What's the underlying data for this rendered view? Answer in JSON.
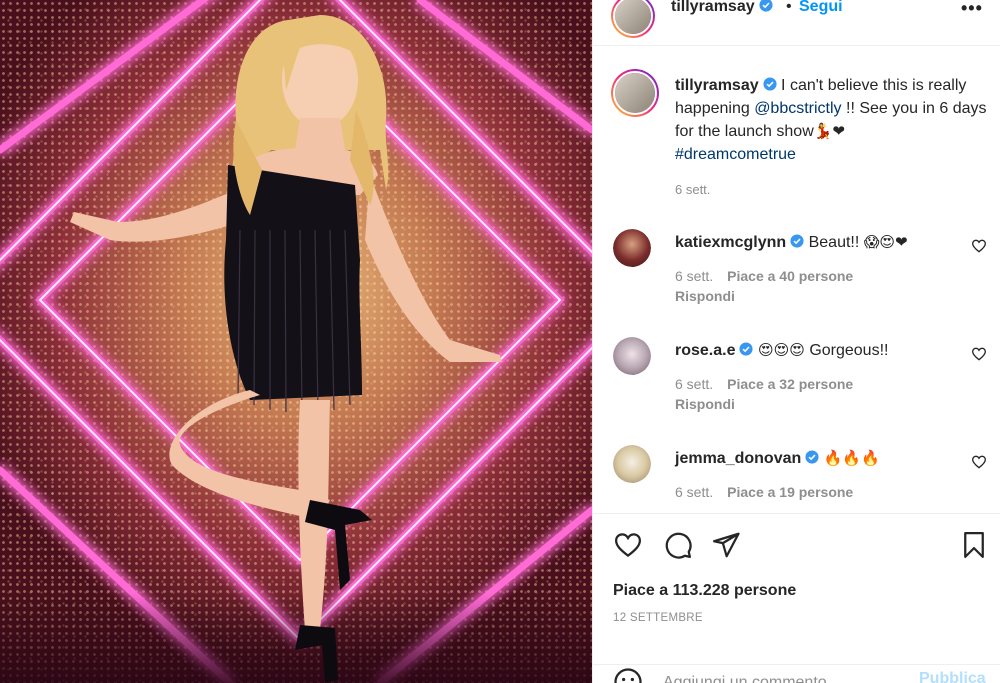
{
  "photo": {
    "description_icon": "photo-dancer",
    "neon_color": "#ff6ad5",
    "dress_color": "#141018",
    "hair_color": "#e9c27a"
  },
  "header": {
    "username": "tillyramsay",
    "separator": "•",
    "follow_label": "Segui",
    "more_icon": "more-horizontal-icon",
    "more_label": "•••"
  },
  "caption": {
    "username": "tillyramsay",
    "text_before": " I can't believe this is really happening ",
    "mention": "@bbcstrictly",
    "text_after": " !! See you in 6 days for the launch show",
    "emoji": "💃❤",
    "hashtag": "#dreamcometrue",
    "time": "6 sett."
  },
  "comments": [
    {
      "username": "katiexmcglynn",
      "verified": true,
      "text": "Beaut!!",
      "emoji": "😱😍❤",
      "time": "6 sett.",
      "likes": "Piace a 40 persone",
      "reply": "Rispondi",
      "avatar_color": "#7a2b2b"
    },
    {
      "username": "rose.a.e",
      "verified": true,
      "emoji": "😍😍😍",
      "text": "Gorgeous!!",
      "time": "6 sett.",
      "likes": "Piace a 32 persone",
      "reply": "Rispondi",
      "avatar_color": "#b8a7b3"
    },
    {
      "username": "jemma_donovan",
      "verified": true,
      "emoji": "🔥🔥🔥",
      "text": "",
      "time": "6 sett.",
      "likes": "Piace a 19 persone",
      "avatar_color": "#d9c9a3"
    }
  ],
  "actions": {
    "like_icon": "heart-icon",
    "comment_icon": "comment-icon",
    "share_icon": "send-icon",
    "save_icon": "bookmark-icon",
    "likes_count": "Piace a 113.228 persone",
    "date": "12 SETTEMBRE"
  },
  "add_comment": {
    "emoji_icon": "emoji-icon",
    "placeholder": "Aggiungi un commento...",
    "publish_label": "Pubblica"
  },
  "colors": {
    "accent": "#0095f6",
    "link": "#00376b",
    "muted": "#8e8e8e",
    "publish_disabled": "#b2dffc"
  }
}
